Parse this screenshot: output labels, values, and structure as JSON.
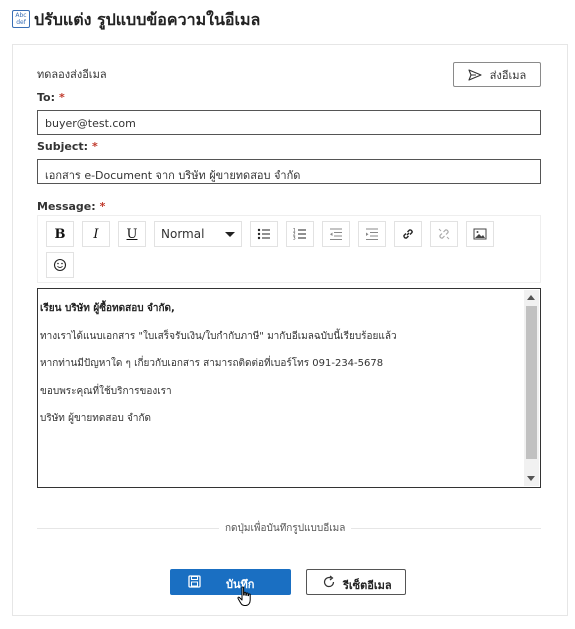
{
  "header": {
    "icon_text_top": "Abc",
    "icon_text_bottom": "def",
    "title": "ปรับแต่ง รูปแบบข้อความในอีเมล"
  },
  "form": {
    "section_title": "ทดลองส่งอีเมล",
    "send_button_label": "ส่งอีเมล",
    "to_label": "To:",
    "to_value": "buyer@test.com",
    "subject_label": "Subject:",
    "subject_value": "เอกสาร e-Document จาก บริษัท ผู้ขายทดสอบ จำกัด",
    "message_label": "Message:",
    "required_mark": "*"
  },
  "toolbar": {
    "bold": "B",
    "italic": "I",
    "underline": "U",
    "format_select": "Normal",
    "icons": [
      "bullet-list-icon",
      "numbered-list-icon",
      "outdent-icon",
      "indent-icon",
      "link-icon",
      "unlink-icon",
      "image-icon",
      "emoji-icon"
    ]
  },
  "editor": {
    "lines": [
      "เรียน บริษัท ผู้ซื้อทดสอบ จำกัด,",
      "ทางเราได้แนบเอกสาร \"ใบเสร็จรับเงิน/ใบกำกับภาษี\" มากับอีเมลฉบับนี้เรียบร้อยแล้ว",
      "หากท่านมีปัญหาใด ๆ เกี่ยวกับเอกสาร สามารถติดต่อที่เบอร์โทร 091-234-5678",
      "ขอบพระคุณที่ใช้บริการของเรา",
      "บริษัท ผู้ขายทดสอบ จำกัด"
    ]
  },
  "footer": {
    "divider_text": "กดปุ่มเพื่อบันทึกรูปแบบอีเมล",
    "save_label": "บันทึก",
    "reset_label": "รีเซ็ตอีเมล"
  },
  "colors": {
    "primary": "#1a6fc2",
    "required": "#c0392b",
    "header_icon": "#3a6fb5"
  }
}
